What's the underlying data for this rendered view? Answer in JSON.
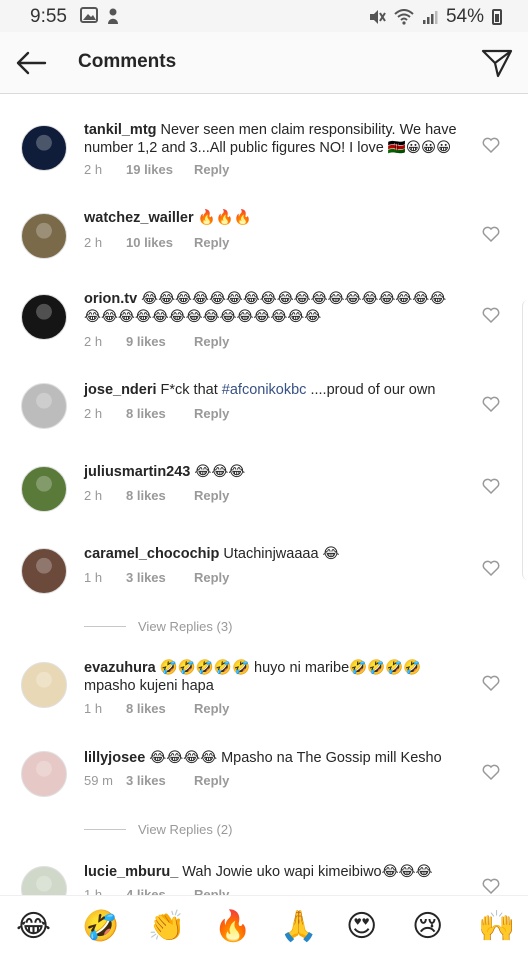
{
  "status": {
    "time": "9:55",
    "battery": "54%"
  },
  "header": {
    "title": "Comments"
  },
  "comments": [
    {
      "user": "tankil_mtg",
      "text": "Never seen men claim responsibility. We have number 1,2 and 3...All public figures NO! I love 🇰🇪😀😀😀",
      "time": "2 h",
      "likes": "19 likes",
      "reply": "Reply"
    },
    {
      "user": "watchez_wailler",
      "text": "🔥🔥🔥",
      "time": "2 h",
      "likes": "10 likes",
      "reply": "Reply"
    },
    {
      "user": "orion.tv",
      "text": "😂😂😂😂😂😂😂😂😂😂😂😂😂😂😂😂😂😂😂😂😂😂😂😂😂😂😂😂😂😂😂😂",
      "time": "2 h",
      "likes": "9 likes",
      "reply": "Reply"
    },
    {
      "user": "jose_nderi",
      "text_before": "F*ck that ",
      "tag": "#afconikokbc",
      "text_after": " ....proud of our own",
      "time": "2 h",
      "likes": "8 likes",
      "reply": "Reply"
    },
    {
      "user": "juliusmartin243",
      "text": "😂😂😂",
      "time": "2 h",
      "likes": "8 likes",
      "reply": "Reply"
    },
    {
      "user": "caramel_chocochip",
      "text": "Utachinjwaaaa 😂",
      "time": "1 h",
      "likes": "3 likes",
      "reply": "Reply",
      "view_replies": "View Replies (3)"
    },
    {
      "user": "evazuhura",
      "text": "🤣🤣🤣🤣🤣 huyo ni maribe🤣🤣🤣🤣 mpasho kujeni hapa",
      "time": "1 h",
      "likes": "8 likes",
      "reply": "Reply"
    },
    {
      "user": "lillyjosee",
      "text": "😂😂😂😂 Mpasho na The Gossip mill Kesho",
      "time": "59 m",
      "likes": "3 likes",
      "reply": "Reply",
      "view_replies": "View Replies (2)"
    },
    {
      "user": "lucie_mburu_",
      "text": "Wah Jowie uko wapi kimeibiwo😂😂😂",
      "time": "1 h",
      "likes": "4 likes",
      "reply": "Reply"
    }
  ],
  "avatar_colors": [
    "#0f1d3a",
    "#7a6a4a",
    "#151515",
    "#bcbcbc",
    "#5a7a3a",
    "#6b4a3c",
    "#e8d8b5",
    "#e6c8c6",
    "#cfd8c9"
  ],
  "emoji_bar": [
    "😂",
    "🤣",
    "👏",
    "🔥",
    "🙏",
    "😍",
    "😢",
    "🙌"
  ]
}
